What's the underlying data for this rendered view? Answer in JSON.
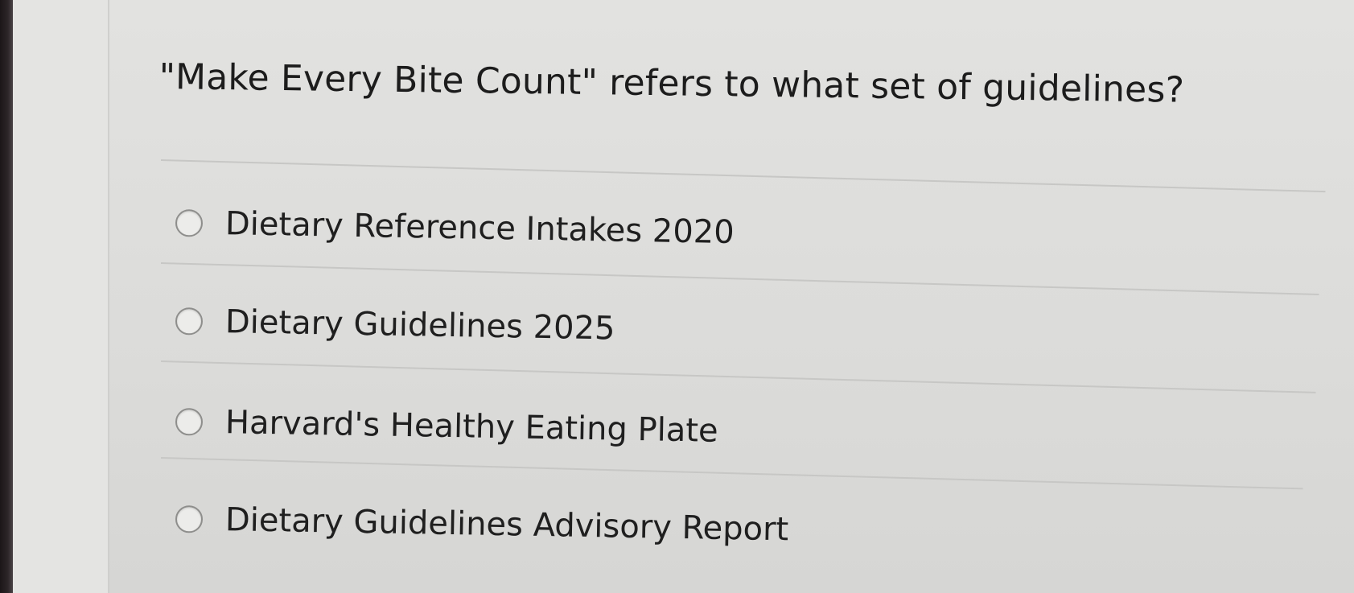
{
  "question": {
    "text": "\"Make Every Bite Count\" refers to what set of guidelines?"
  },
  "options": [
    {
      "label": "Dietary Reference Intakes 2020",
      "selected": false
    },
    {
      "label": "Dietary Guidelines 2025",
      "selected": false
    },
    {
      "label": "Harvard's Healthy Eating Plate",
      "selected": false
    },
    {
      "label": "Dietary Guidelines Advisory Report",
      "selected": false
    }
  ]
}
